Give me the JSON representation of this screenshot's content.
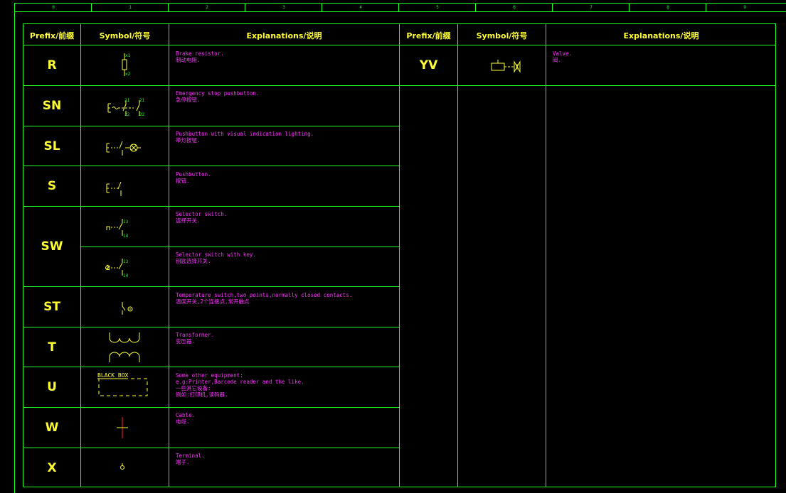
{
  "ruler": [
    "0",
    "1",
    "2",
    "3",
    "4",
    "5",
    "6",
    "7",
    "8",
    "9"
  ],
  "headers": {
    "prefix": "Prefix/前缀",
    "symbol": "Symbol/符号",
    "explanations": "Explanations/说明"
  },
  "left_rows": [
    {
      "prefix": "R",
      "lines": [
        "Brake resistor.",
        "制动电阻."
      ]
    },
    {
      "prefix": "SN",
      "lines": [
        "Emergency stop pushbutton.",
        "急停按钮."
      ]
    },
    {
      "prefix": "SL",
      "lines": [
        "Pushbutton with visual indication lighting.",
        "带灯按钮."
      ]
    },
    {
      "prefix": "S",
      "lines": [
        "Pushbutton.",
        "按钮."
      ]
    },
    {
      "prefix": "SW",
      "lines": [
        "Selector switch.",
        "选择开关."
      ]
    },
    {
      "prefix": "",
      "lines": [
        "Selector switch with key.",
        "钥匙选择开关."
      ]
    },
    {
      "prefix": "ST",
      "lines": [
        "Temperature switch,two points,normally closed contacts.",
        "温度开关,2个连接点,常开触点"
      ]
    },
    {
      "prefix": "T",
      "lines": [
        "Transformer.",
        "变压器."
      ]
    },
    {
      "prefix": "U",
      "lines": [
        "Some other equipment:",
        "e.g:Printer,Barcode reader and the like.",
        "一些其它设备:",
        "例如:打印机,读码器."
      ]
    },
    {
      "prefix": "W",
      "lines": [
        "Cable.",
        "电缆."
      ]
    },
    {
      "prefix": "X",
      "lines": [
        "Terminal.",
        "端子."
      ]
    }
  ],
  "right_rows": [
    {
      "prefix": "YV",
      "lines": [
        "Valve.",
        "阀."
      ]
    }
  ],
  "symbol_labels": {
    "x1": "x1",
    "x2": "x2",
    "c21": "21",
    "c22": "22",
    "c13": "13",
    "c14": "14",
    "black_box": "BLACK_BOX"
  },
  "colors": {
    "grid": "#22ff22",
    "prefix": "#ffff33",
    "explanation": "#ff33ff",
    "symbol": "#ffff33",
    "cable": "#ff2222"
  }
}
